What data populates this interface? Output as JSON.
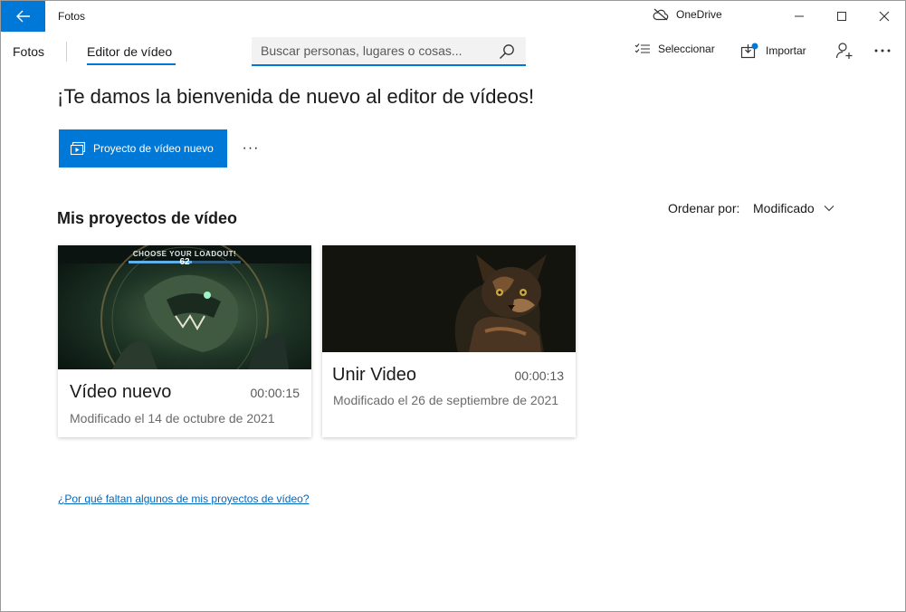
{
  "window": {
    "title": "Fotos",
    "onedrive_label": "OneDrive"
  },
  "nav": {
    "fotos_label": "Fotos",
    "editor_label": "Editor de vídeo",
    "search_placeholder": "Buscar personas, lugares o cosas...",
    "select_label": "Seleccionar",
    "import_label": "Importar"
  },
  "main": {
    "welcome": "¡Te damos la bienvenida de nuevo al editor de vídeos!",
    "new_project_label": "Proyecto de vídeo nuevo",
    "more_label": "···",
    "section_title": "Mis proyectos de vídeo",
    "sort_label": "Ordenar por:",
    "sort_value": "Modificado",
    "help_link": "¿Por qué faltan algunos de mis proyectos de vídeo?"
  },
  "projects": [
    {
      "title": "Vídeo nuevo",
      "duration": "00:00:15",
      "modified": "Modificado el 14 de octubre de 2021",
      "thumb_text": "CHOOSE YOUR LOADOUT!",
      "thumb_number": "62"
    },
    {
      "title": "Unir Video",
      "duration": "00:00:13",
      "modified": "Modificado el 26 de septiembre de 2021"
    }
  ],
  "colors": {
    "accent": "#0078d7",
    "link": "#0067c0"
  }
}
